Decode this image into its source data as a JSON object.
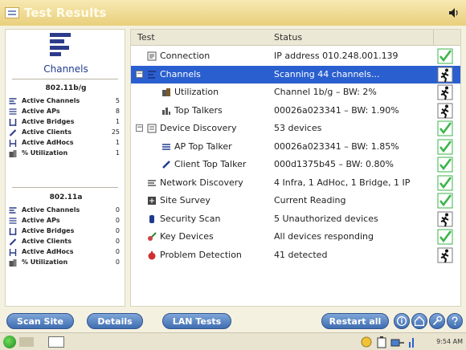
{
  "app": {
    "title": "Test Results"
  },
  "left_panel": {
    "channels_label": "Channels",
    "bands": [
      {
        "title": "802.11b/g",
        "stats": [
          {
            "icon": "channels-icon",
            "label": "Active Channels",
            "value": "5"
          },
          {
            "icon": "access-points-icon",
            "label": "Active APs",
            "value": "8"
          },
          {
            "icon": "bridges-icon",
            "label": "Active Bridges",
            "value": "1"
          },
          {
            "icon": "clients-icon",
            "label": "Active Clients",
            "value": "25"
          },
          {
            "icon": "adhocs-icon",
            "label": "Active AdHocs",
            "value": "1"
          },
          {
            "icon": "utilization-icon",
            "label": "% Utilization",
            "value": "1"
          }
        ]
      },
      {
        "title": "802.11a",
        "stats": [
          {
            "icon": "channels-icon",
            "label": "Active Channels",
            "value": "0"
          },
          {
            "icon": "access-points-icon",
            "label": "Active APs",
            "value": "0"
          },
          {
            "icon": "bridges-icon",
            "label": "Active Bridges",
            "value": "0"
          },
          {
            "icon": "clients-icon",
            "label": "Active Clients",
            "value": "0"
          },
          {
            "icon": "adhocs-icon",
            "label": "Active AdHocs",
            "value": "0"
          },
          {
            "icon": "utilization-icon",
            "label": "% Utilization",
            "value": "0"
          }
        ]
      }
    ]
  },
  "table": {
    "columns": [
      "Test",
      "Status"
    ],
    "rows": [
      {
        "name": "Connection",
        "status": "IP address 010.248.001.139",
        "state": "pass",
        "icon": "connection-icon",
        "level": 1,
        "selected": false,
        "expander": ""
      },
      {
        "name": "Channels",
        "status": "Scanning 44 channels...",
        "state": "running",
        "icon": "channels-icon",
        "level": 1,
        "selected": true,
        "expander": "−"
      },
      {
        "name": "Utilization",
        "status": "Channel 1b/g – BW: 2%",
        "state": "running",
        "icon": "utilization-icon",
        "level": 2,
        "selected": false,
        "expander": ""
      },
      {
        "name": "Top Talkers",
        "status": "00026a023341 – BW: 1.90%",
        "state": "running",
        "icon": "top-talkers-icon",
        "level": 2,
        "selected": false,
        "expander": ""
      },
      {
        "name": "Device Discovery",
        "status": "53 devices",
        "state": "pass",
        "icon": "device-discovery-icon",
        "level": 1,
        "selected": false,
        "expander": "−"
      },
      {
        "name": "AP Top Talker",
        "status": "00026a023341 – BW: 1.85%",
        "state": "pass",
        "icon": "ap-icon",
        "level": 2,
        "selected": false,
        "expander": ""
      },
      {
        "name": "Client Top Talker",
        "status": "000d1375b45 – BW: 0.80%",
        "state": "pass",
        "icon": "client-icon",
        "level": 2,
        "selected": false,
        "expander": ""
      },
      {
        "name": "Network Discovery",
        "status": "4 Infra, 1 AdHoc, 1 Bridge, 1 IP",
        "state": "pass",
        "icon": "network-discovery-icon",
        "level": 1,
        "selected": false,
        "expander": ""
      },
      {
        "name": "Site Survey",
        "status": "Current Reading",
        "state": "pass",
        "icon": "site-survey-icon",
        "level": 1,
        "selected": false,
        "expander": ""
      },
      {
        "name": "Security Scan",
        "status": "5 Unauthorized devices",
        "state": "running",
        "icon": "security-scan-icon",
        "level": 1,
        "selected": false,
        "expander": ""
      },
      {
        "name": "Key Devices",
        "status": "All devices responding",
        "state": "pass",
        "icon": "key-devices-icon",
        "level": 1,
        "selected": false,
        "expander": ""
      },
      {
        "name": "Problem Detection",
        "status": "41 detected",
        "state": "running",
        "icon": "problem-detection-icon",
        "level": 1,
        "selected": false,
        "expander": ""
      }
    ]
  },
  "bottom_bar": {
    "buttons": [
      "Scan Site",
      "Details",
      "LAN Tests"
    ],
    "restart_label": "Restart all"
  },
  "status_bar": {
    "clock": "9:54 AM"
  },
  "colors": {
    "title_bar": "#e9cf7c",
    "selection": "#2a5fd0",
    "button": "#3f6db1",
    "pass": "#3bb54a",
    "link_blue": "#1f3b8f"
  }
}
